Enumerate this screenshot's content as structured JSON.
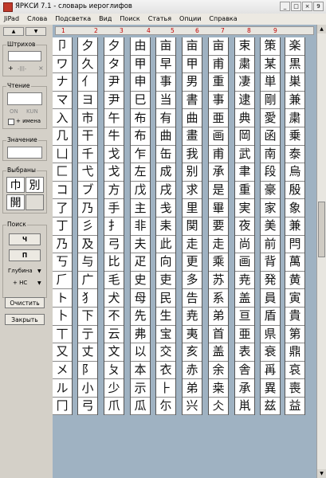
{
  "window": {
    "title": "ЯРКСИ 7.1   -  словарь иероглифов",
    "buttons": [
      "_",
      "□",
      "×",
      "9"
    ]
  },
  "menu": [
    "JiPad",
    "Слова",
    "Подсветка",
    "Вид",
    "Поиск",
    "Статья",
    "Опции",
    "Справка"
  ],
  "left": {
    "strokes": {
      "label": "Штрихов",
      "value": "",
      "ops": [
        "+",
        "-|||-",
        "×"
      ]
    },
    "reading": {
      "label": "Чтение",
      "value": "",
      "on": "ON",
      "kun": "KUN",
      "names": "+ имена"
    },
    "meaning": {
      "label": "Значение",
      "value": ""
    },
    "chosen": {
      "label": "Выбраны",
      "kanji": [
        "巾",
        "別",
        "開",
        ""
      ]
    },
    "search": {
      "label": "Поиск",
      "btn1": "Ч",
      "btn2": "П",
      "depth": "Глубина",
      "hc": "+ НС"
    },
    "clear": "Очистить",
    "close": "Закрыть"
  },
  "grid": {
    "col_numbers": [
      "1",
      "2",
      "3",
      "4",
      "5",
      "6",
      "7",
      "8",
      "9"
    ],
    "columns": [
      [
        "卩",
        "ワ",
        "ナ",
        "マ",
        "入",
        "几",
        "凵",
        "⼕",
        "コ",
        "了",
        "丁",
        "乃",
        "丂",
        "⺁",
        "ト",
        "⼘",
        "丅",
        "又",
        "メ",
        "ル",
        "⼌"
      ],
      [
        "夕",
        "久",
        "⺅",
        "ヨ",
        "市",
        "干",
        "千",
        "弋",
        "ブ",
        "乃",
        "彡",
        "及",
        "与",
        "⼴",
        "⺨",
        "下",
        "亍",
        "丈",
        "⻖",
        "小",
        "⼸"
      ],
      [
        "夕",
        "タ",
        "尹",
        "尹",
        "午",
        "牛",
        "戈",
        "戈",
        "方",
        "手",
        "⺘",
        "弓",
        "比",
        "毛",
        "犬",
        "不",
        "云",
        "文",
        "ㄆ",
        "少",
        "爪"
      ],
      [
        "由",
        "甲",
        "申",
        "⺒",
        "布",
        "布",
        "乍",
        "左",
        "戊",
        "主",
        "非",
        "夫",
        "疋",
        "史",
        "⺟",
        "先",
        "弗",
        "以",
        "本",
        "示",
        "瓜"
      ],
      [
        "亩",
        "早",
        "事",
        "当",
        "有",
        "曲",
        "缶",
        "成",
        "戌",
        "戋",
        "耒",
        "此",
        "向",
        "吏",
        "⺠",
        "生",
        "宝",
        "交",
        "衣",
        "⺊",
        "尓"
      ],
      [
        "亩",
        "甲",
        "男",
        "書",
        "曲",
        "畫",
        "我",
        "别",
        "求",
        "里",
        "関",
        "走",
        "更",
        "多",
        "告",
        "尭",
        "夷",
        "亥",
        "赤",
        "弟",
        "兴"
      ],
      [
        "亩",
        "甫",
        "重",
        "事",
        "亜",
        "画",
        "甫",
        "承",
        "是",
        "畢",
        "要",
        "走",
        "乘",
        "苏",
        "系",
        "弟",
        "首",
        "盖",
        "余",
        "桒",
        "仌"
      ],
      [
        "束",
        "粛",
        "凄",
        "逮",
        "典",
        "岡",
        "武",
        "聿",
        "重",
        "実",
        "夜",
        "尚",
        "画",
        "尭",
        "盖",
        "亘",
        "亜",
        "表",
        "舎",
        "承",
        "鼡"
      ],
      [
        "策",
        "某",
        "単",
        "剛",
        "愛",
        "函",
        "南",
        "段",
        "豪",
        "家",
        "美",
        "前",
        "背",
        "発",
        "員",
        "盾",
        "県",
        "衰",
        "爯",
        "異",
        "兹"
      ],
      [
        "楽",
        "黒",
        "巣",
        "兼",
        "粛",
        "乗",
        "泰",
        "烏",
        "殷",
        "象",
        "兼",
        "閂",
        "萬",
        "黄",
        "寅",
        "貴",
        "第",
        "鼎",
        "哀",
        "喪",
        "益"
      ]
    ]
  },
  "scrollbar": {
    "up": "▲",
    "down": "▼"
  }
}
